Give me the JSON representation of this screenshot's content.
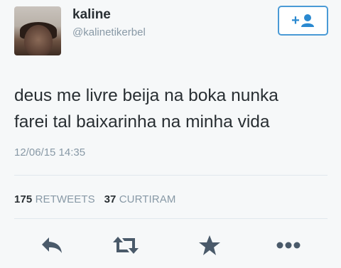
{
  "user": {
    "name": "kaline",
    "handle": "@kalinetikerbel",
    "follow_plus": "+"
  },
  "tweet": {
    "text_line1": "deus me livre beija na boka nunka",
    "text_line2": "farei tal baixarinha na minha vida",
    "timestamp": "12/06/15 14:35"
  },
  "stats": {
    "retweets_count": "175",
    "retweets_label": "RETWEETS",
    "likes_count": "37",
    "likes_label": "CURTIRAM"
  },
  "actions": {
    "icons": [
      "reply-icon",
      "retweet-icon",
      "favorite-icon",
      "more-icon"
    ]
  },
  "colors": {
    "accent": "#2a89d0",
    "text": "#292f33",
    "muted": "#8899a6",
    "icon": "#4a5a6a"
  }
}
